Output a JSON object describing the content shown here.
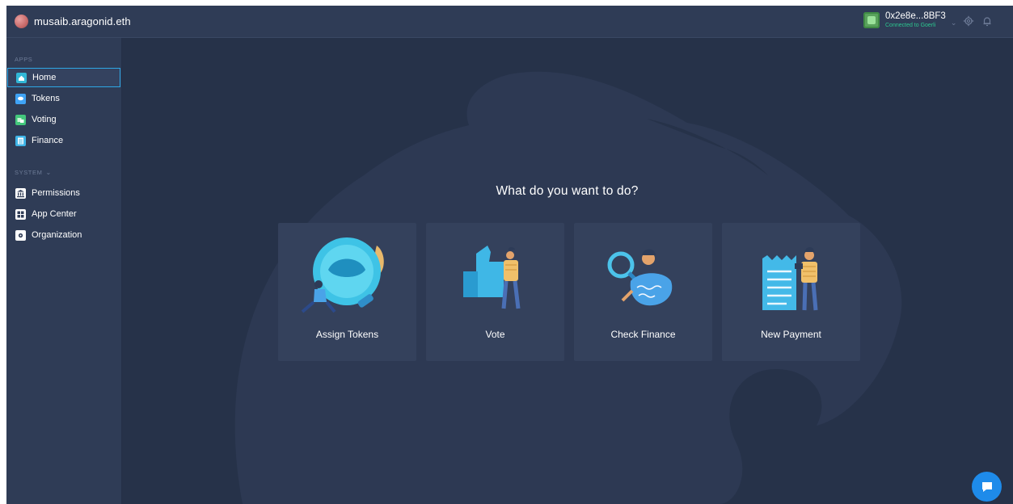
{
  "topbar": {
    "org_name": "musaib.aragonid.eth",
    "account_address": "0x2e8e...8BF3",
    "account_network": "Connected to Goerli",
    "icons": [
      "gear-icon",
      "bell-icon",
      "chevron-down-icon"
    ]
  },
  "sidebar": {
    "apps_label": "APPS",
    "system_label": "SYSTEM",
    "apps": [
      {
        "label": "Home",
        "icon": "home-icon",
        "color": "#31b7d6",
        "active": true
      },
      {
        "label": "Tokens",
        "icon": "tokens-icon",
        "color": "#3fa3f5"
      },
      {
        "label": "Voting",
        "icon": "voting-icon",
        "color": "#43c77c"
      },
      {
        "label": "Finance",
        "icon": "finance-icon",
        "color": "#3fb5e8"
      }
    ],
    "system": [
      {
        "label": "Permissions",
        "icon": "permissions-icon"
      },
      {
        "label": "App Center",
        "icon": "app-center-icon"
      },
      {
        "label": "Organization",
        "icon": "organization-icon"
      }
    ]
  },
  "main": {
    "headline": "What do you want to do?",
    "actions": [
      {
        "label": "Assign Tokens",
        "icon": "assign-tokens-illustration"
      },
      {
        "label": "Vote",
        "icon": "vote-illustration"
      },
      {
        "label": "Check Finance",
        "icon": "check-finance-illustration"
      },
      {
        "label": "New Payment",
        "icon": "new-payment-illustration"
      }
    ]
  },
  "colors": {
    "background": "#263249",
    "panel": "#2f3c56",
    "card": "#34415c",
    "accent": "#2ea8e6",
    "connected": "#2cc68f",
    "chat": "#1e8bea"
  },
  "chat": {
    "icon": "chat-icon"
  }
}
